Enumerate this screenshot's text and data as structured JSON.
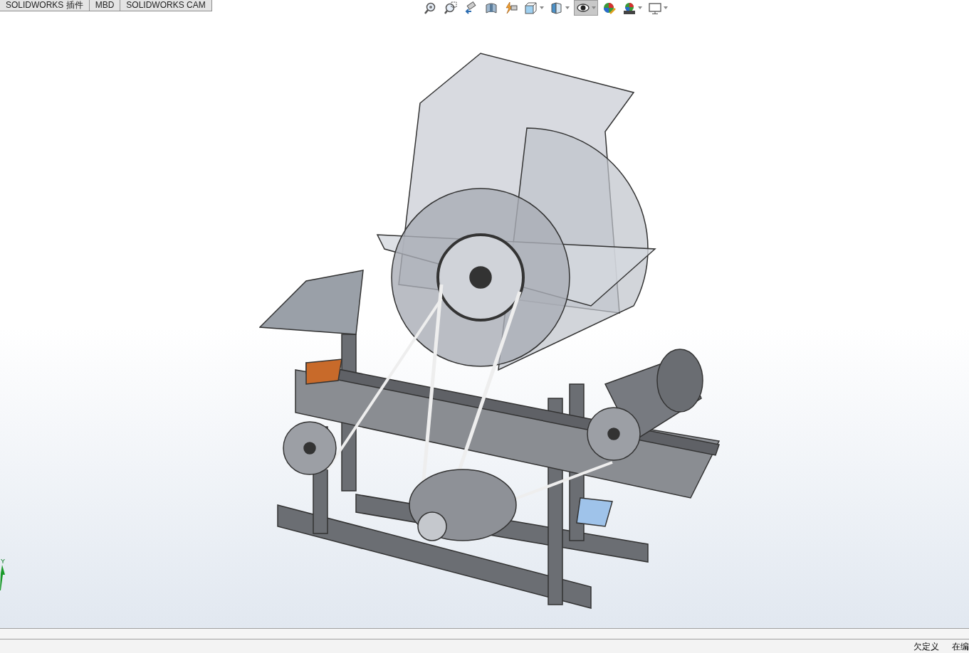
{
  "command_tabs": [
    {
      "label": "SOLIDWORKS 插件"
    },
    {
      "label": "MBD"
    },
    {
      "label": "SOLIDWORKS CAM"
    }
  ],
  "view_toolbar": [
    {
      "kind": "zoom-fit",
      "dropdown": false,
      "selected": false
    },
    {
      "kind": "zoom-area",
      "dropdown": false,
      "selected": false
    },
    {
      "kind": "previous-view",
      "dropdown": false,
      "selected": false
    },
    {
      "kind": "section",
      "dropdown": false,
      "selected": false
    },
    {
      "kind": "dynamic",
      "dropdown": false,
      "selected": false
    },
    {
      "kind": "orientation",
      "dropdown": true,
      "selected": false
    },
    {
      "kind": "display-style",
      "dropdown": true,
      "selected": false
    },
    {
      "kind": "hide-show",
      "dropdown": true,
      "selected": true
    },
    {
      "kind": "edit-appearance",
      "dropdown": false,
      "selected": false
    },
    {
      "kind": "scene",
      "dropdown": true,
      "selected": false
    },
    {
      "kind": "display",
      "dropdown": true,
      "selected": false
    }
  ],
  "triad": {
    "axis_label": "Y"
  },
  "status_bar": {
    "items": [
      "欠定义",
      "在编"
    ]
  }
}
